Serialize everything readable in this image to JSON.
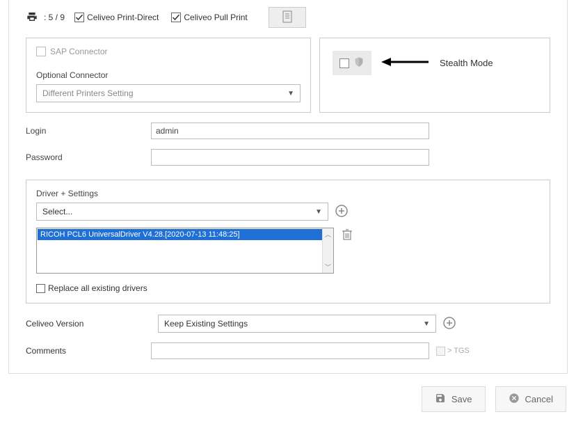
{
  "header": {
    "count": ": 5 / 9",
    "printDirect": "Celiveo Print-Direct",
    "pullPrint": "Celiveo Pull Print"
  },
  "connector": {
    "sap": "SAP Connector",
    "optionalLabel": "Optional Connector",
    "optionalValue": "Different Printers Setting"
  },
  "stealth": {
    "label": "Stealth Mode"
  },
  "login": {
    "label": "Login",
    "value": "admin"
  },
  "password": {
    "label": "Password",
    "value": ""
  },
  "driver": {
    "label": "Driver + Settings",
    "selectValue": "Select...",
    "listItem": "RICOH PCL6 UniversalDriver V4.28.[2020-07-13 11:48:25]",
    "replaceLabel": "Replace all existing drivers"
  },
  "version": {
    "label": "Celiveo Version",
    "value": "Keep Existing Settings"
  },
  "comments": {
    "label": "Comments",
    "value": "",
    "tgs": "> TGS"
  },
  "footer": {
    "save": "Save",
    "cancel": "Cancel"
  }
}
